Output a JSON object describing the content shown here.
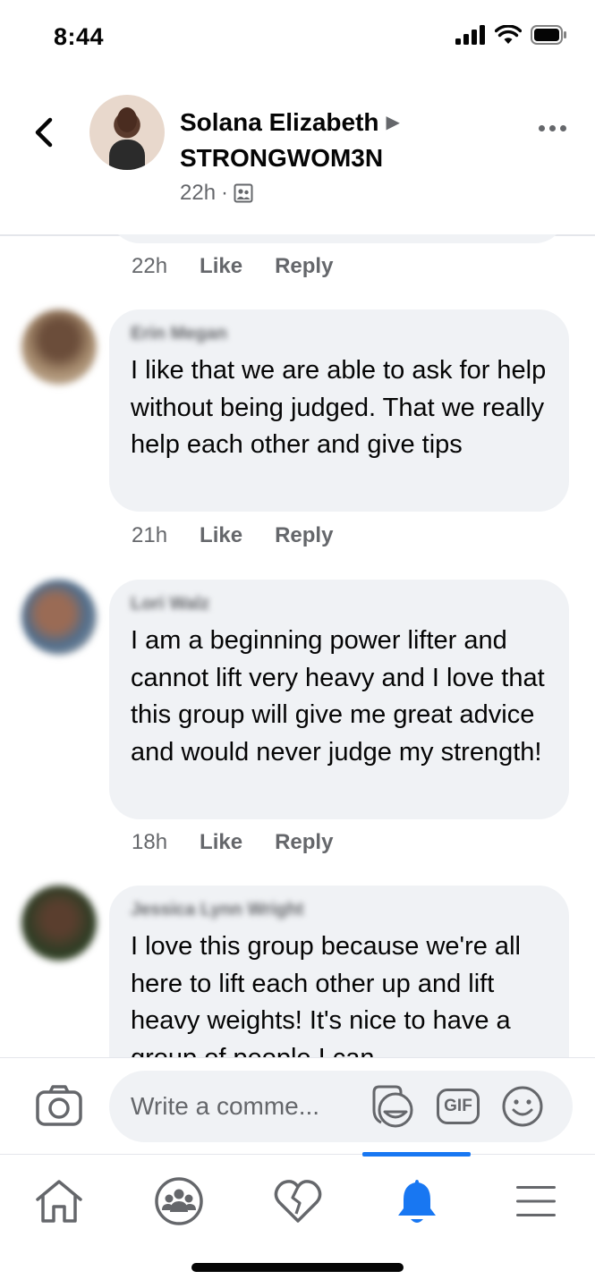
{
  "status_bar": {
    "time": "8:44"
  },
  "header": {
    "name": "Solana Elizabeth",
    "group": "STRONGWOM3N",
    "time": "22h",
    "separator": "·"
  },
  "comments": [
    {
      "time": "22h",
      "like": "Like",
      "reply": "Reply"
    },
    {
      "author": "Erin Megan",
      "text": "I like that we are able to ask for help without being judged. That we really help each other and give tips",
      "time": "21h",
      "like": "Like",
      "reply": "Reply",
      "avatar_color": "#8b6a54"
    },
    {
      "author": "Lori Walz",
      "text": "I am a beginning power lifter and cannot lift very heavy and I love that this group will give me great advice and would never judge my strength!",
      "time": "18h",
      "like": "Like",
      "reply": "Reply",
      "avatar_color": "#7f8ea0"
    },
    {
      "author": "Jessica Lynn Wright",
      "text": "I love this group because we're all here to lift each other up and lift heavy weights! It's nice to have a group of people I can",
      "avatar_color": "#3b4a2e"
    }
  ],
  "composer": {
    "placeholder": "Write a comme...",
    "gif_label": "GIF"
  },
  "nav": {
    "active": "notifications",
    "accent_color": "#1877f2"
  }
}
